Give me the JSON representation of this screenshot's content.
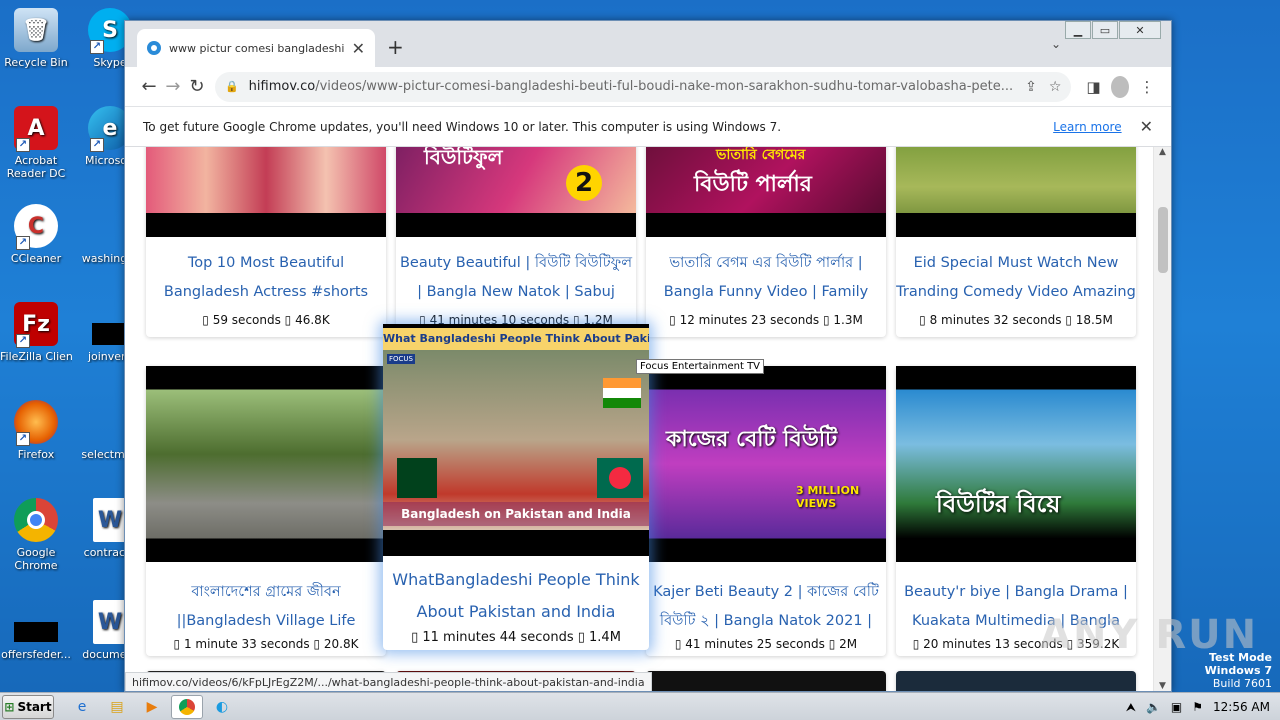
{
  "desktop": {
    "icons": [
      {
        "label": "Recycle Bin"
      },
      {
        "label": "Skype"
      },
      {
        "label": "Acrobat Reader DC"
      },
      {
        "label": "Microsoft"
      },
      {
        "label": "CCleaner"
      },
      {
        "label": "washingto"
      },
      {
        "label": "FileZilla Client"
      },
      {
        "label": "joinvery"
      },
      {
        "label": "Firefox"
      },
      {
        "label": "selectmen"
      },
      {
        "label": "Google Chrome"
      },
      {
        "label": "contractb"
      },
      {
        "label": "offersfeder..."
      },
      {
        "label": "document"
      }
    ]
  },
  "browser": {
    "tab": {
      "title": "www pictur comesi bangladeshi beut"
    },
    "url_host": "hifimov.co",
    "url_path": "/videos/www-pictur-comesi-bangladeshi-beuti-ful-boudi-nake-mon-sarakhon-sudhu-tomar-valobasha-pete...",
    "infobar": {
      "message": "To get future Google Chrome updates, you'll need Windows 10 or later. This computer is using Windows 7.",
      "learn_more": "Learn more"
    },
    "status_url": "hifimov.co/videos/6/kFpLJrEgZ2M/.../what-bangladeshi-people-think-about-pakistan-and-india"
  },
  "videos_row1": [
    {
      "title": "Top 10 Most Beautiful Bangladesh Actress #shorts video",
      "duration": "59 seconds",
      "views": "46.8K"
    },
    {
      "title": "Beauty Beautiful | বিউটি বিউটিফুল | Bangla New Natok | Sabuj Ahmed",
      "duration": "41 minutes 10 seconds",
      "views": "1.2M"
    },
    {
      "title": "ভাতারি বেগম এর বিউটি পার্লার | Bangla Funny Video | Family",
      "duration": "12 minutes 23 seconds",
      "views": "1.3M"
    },
    {
      "title": "Eid Special Must Watch New Tranding Comedy Video Amazing",
      "duration": "8 minutes 32 seconds",
      "views": "18.5M"
    }
  ],
  "videos_row2": [
    {
      "title": "বাংলাদেশের গ্রামের জীবন ||Bangladesh Village Life",
      "duration": "1 minute 33 seconds",
      "views": "20.8K"
    },
    {
      "title": "WhatBangladeshi People Think About Pakistan and India",
      "duration": "11 minutes 44 seconds",
      "views": "1.4M",
      "thumb_top_text": "What Bangladeshi People Think About Pakistan and India",
      "thumb_bottom_text": "Bangladesh on Pakistan and India",
      "thumb_badge": "FOCUS"
    },
    {
      "title": "Kajer Beti Beauty 2 | কাজের বেটি বিউটি ২ | Bangla Natok 2021 |",
      "duration": "41 minutes 25 seconds",
      "views": "2M",
      "thumb_text": "কাজের বেটি বিউটি",
      "thumb_badge": "3 MILLION VIEWS"
    },
    {
      "title": "Beauty'r biye | Bangla Drama | Kuakata Multimedia | Bangla New",
      "duration": "20 minutes 13 seconds",
      "views": "359.2K",
      "thumb_text": "বিউটির বিয়ে"
    }
  ],
  "thumb_texts_row1": {
    "card2": "বিউটিফুল",
    "card2_badge": "2",
    "card3": "বিউটি পার্লার",
    "card3_top": "ভাতারি বেগমের"
  },
  "tooltip": "Focus Entertainment TV",
  "taskbar": {
    "start": "Start",
    "clock": "12:56 AM"
  },
  "watermark": {
    "line1": "Test Mode",
    "line2": "Windows 7",
    "line3": "Build 7601",
    "anyrun": "ANY RUN"
  },
  "colors": {
    "link": "#2962b0",
    "accent": "#1a73e8"
  }
}
